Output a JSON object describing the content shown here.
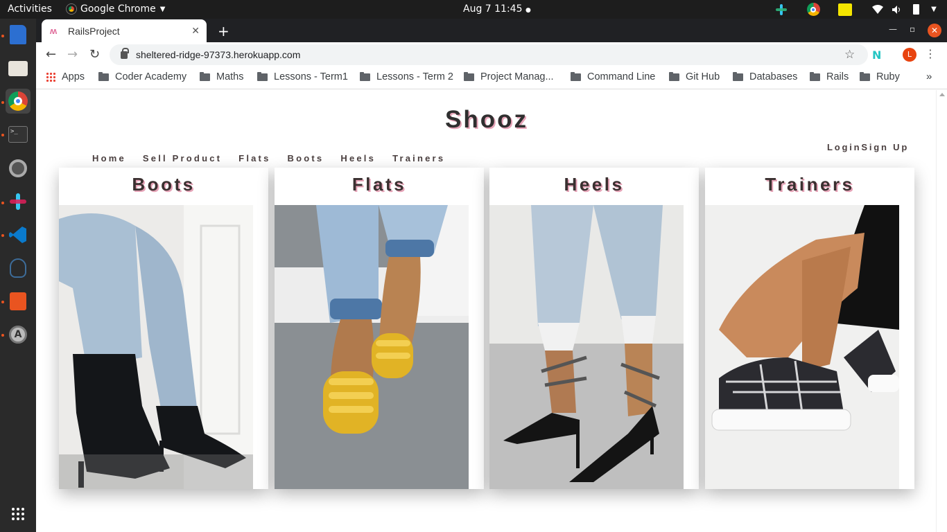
{
  "system": {
    "activities": "Activities",
    "app_name": "Google Chrome",
    "clock": "Aug 7  11:45"
  },
  "browser": {
    "tab_title": "RailsProject",
    "url": "sheltered-ridge-97373.herokuapp.com",
    "profile_initial": "L",
    "bookmarks": [
      "Apps",
      "Coder Academy",
      "Maths",
      "Lessons - Term1",
      "Lessons - Term 2",
      "Project Manag...",
      "Command Line",
      "Git Hub",
      "Databases",
      "Rails",
      "Ruby"
    ]
  },
  "site": {
    "title": "Shooz",
    "nav": [
      "Home",
      "Sell Product",
      "Flats",
      "Boots",
      "Heels",
      "Trainers"
    ],
    "auth": {
      "login": "Login",
      "signup": "Sign Up"
    },
    "categories": [
      {
        "name": "Boots",
        "image": "black lace-up stiletto sock boots with light wash jeans"
      },
      {
        "name": "Flats",
        "image": "yellow strappy flat sandals with cuffed jeans"
      },
      {
        "name": "Heels",
        "image": "black pointed heels with glitter ankle ties and ripped jeans"
      },
      {
        "name": "Trainers",
        "image": "black and white plaid chunky trainers"
      }
    ]
  },
  "colors": {
    "accent_shadow": "#e6a3b7",
    "heading": "#2f2f2f",
    "nav_text": "#4b4040"
  }
}
